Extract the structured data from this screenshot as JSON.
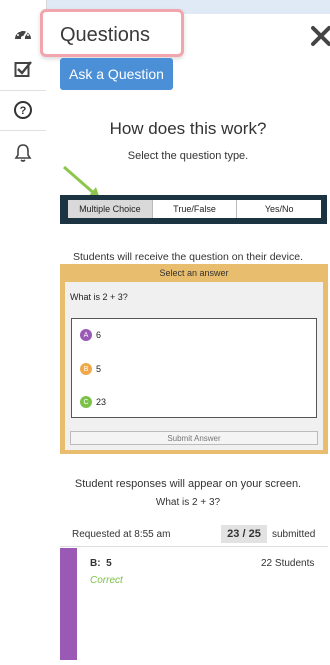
{
  "header": {
    "title": "Questions"
  },
  "sidebar": {
    "items": [
      {
        "name": "dashboard-icon"
      },
      {
        "name": "checkbox-icon"
      },
      {
        "name": "question-icon"
      },
      {
        "name": "bell-icon"
      }
    ]
  },
  "ask_button": "Ask a Question",
  "how": {
    "heading": "How does this work?",
    "select_type": "Select the question type.",
    "types": [
      "Multiple Choice",
      "True/False",
      "Yes/No"
    ],
    "receive_text": "Students will receive the question on their device."
  },
  "device": {
    "header": "Select an answer",
    "question": "What is 2 + 3?",
    "answers": [
      {
        "letter": "A",
        "value": "6",
        "color": "#9b59b6"
      },
      {
        "letter": "B",
        "value": "5",
        "color": "#f0a94a"
      },
      {
        "letter": "C",
        "value": "23",
        "color": "#7cc14a"
      }
    ],
    "submit": "Submit Answer"
  },
  "responses": {
    "intro": "Student responses will appear on your screen.",
    "question": "What is 2 + 3?",
    "requested": "Requested at 8:55 am",
    "count": "23 / 25",
    "submitted": "submitted",
    "result": {
      "answer": "B:  5",
      "students": "22 Students",
      "status": "Correct"
    }
  },
  "colors": {
    "accent": "#4b8fd6",
    "highlight": "#f1a5ad",
    "correct": "#7cc14a"
  }
}
